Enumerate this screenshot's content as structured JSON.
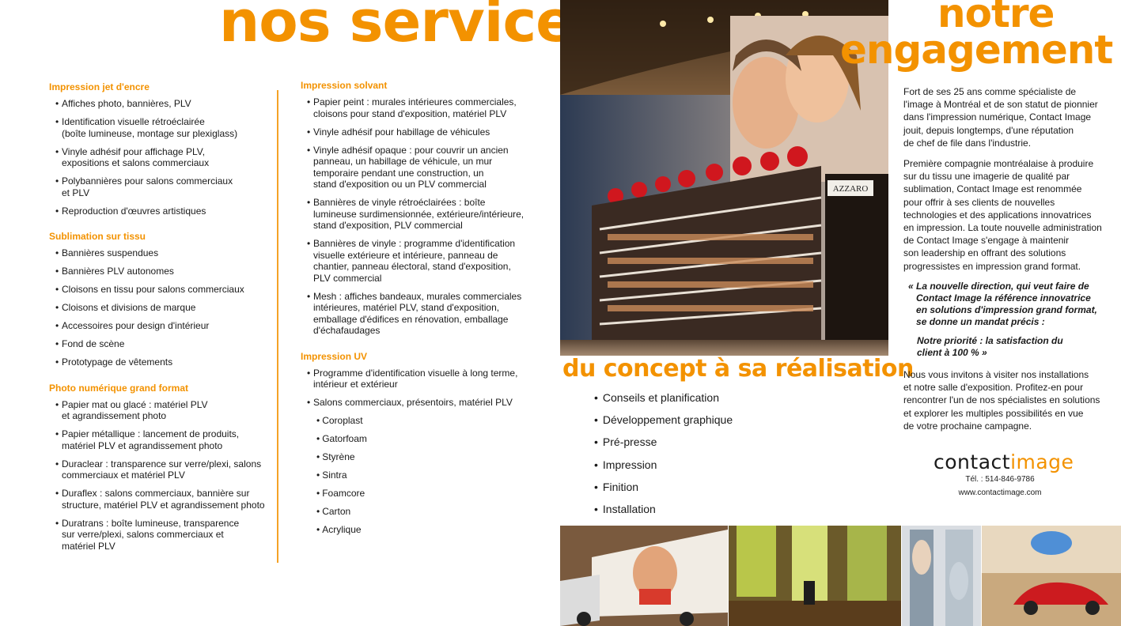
{
  "colors": {
    "accent": "#f39200",
    "text": "#1a1a1a"
  },
  "left": {
    "title": "nos services",
    "col1": [
      {
        "heading": "Impression jet d'encre",
        "items": [
          "Affiches photo, bannières, PLV",
          "Identification visuelle rétroéclairée\n(boîte lumineuse, montage sur plexiglass)",
          "Vinyle adhésif pour affichage PLV,\nexpositions et salons commerciaux",
          "Polybannières pour salons commerciaux\net PLV",
          "Reproduction d'œuvres artistiques"
        ]
      },
      {
        "heading": "Sublimation sur tissu",
        "items": [
          "Bannières suspendues",
          "Bannières PLV autonomes",
          "Cloisons en tissu pour salons commerciaux",
          "Cloisons et divisions de marque",
          "Accessoires pour design d'intérieur",
          "Fond de scène",
          "Prototypage de vêtements"
        ]
      },
      {
        "heading": "Photo numérique grand format",
        "items": [
          "Papier mat ou glacé : matériel PLV\net agrandissement photo",
          "Papier métallique : lancement de produits,\nmatériel PLV et agrandissement photo",
          "Duraclear : transparence sur verre/plexi, salons\ncommerciaux et matériel PLV",
          "Duraflex : salons commerciaux, bannière sur\nstructure, matériel PLV et agrandissement photo",
          "Duratrans : boîte lumineuse, transparence\nsur verre/plexi, salons commerciaux et\nmatériel PLV"
        ]
      }
    ],
    "col2": [
      {
        "heading": "Impression solvant",
        "items": [
          "Papier peint : murales intérieures commerciales,\ncloisons pour stand d'exposition, matériel PLV",
          "Vinyle adhésif pour habillage de véhicules",
          "Vinyle adhésif opaque : pour couvrir un ancien\npanneau, un habillage de véhicule, un mur\ntemporaire pendant une construction, un\nstand d'exposition ou un PLV commercial",
          "Bannières de vinyle rétroéclairées : boîte\nlumineuse surdimensionnée, extérieure/intérieure,\nstand d'exposition, PLV commercial",
          "Bannières de vinyle : programme d'identification\nvisuelle extérieure et intérieure, panneau de\nchantier, panneau électoral, stand d'exposition,\nPLV commercial",
          "Mesh : affiches bandeaux, murales commerciales\nintérieures, matériel PLV, stand d'exposition,\nemballage d'édifices en rénovation, emballage\nd'échafaudages"
        ]
      },
      {
        "heading": "Impression UV",
        "items": [
          "Programme d'identification visuelle à long terme,\nintérieur et extérieur",
          "Salons commerciaux, présentoirs, matériel PLV"
        ],
        "subitems": [
          "Coroplast",
          "Gatorfoam",
          "Styrène",
          "Sintra",
          "Foamcore",
          "Carton",
          "Acrylique"
        ]
      }
    ]
  },
  "middle": {
    "photo_sign": "AZZARO",
    "concept_title": "du concept à sa réalisation",
    "concept_items": [
      "Conseils et planification",
      "Développement graphique",
      "Pré-presse",
      "Impression",
      "Finition",
      "Installation"
    ]
  },
  "right": {
    "title_line1": "notre",
    "title_line2": "engagement",
    "paragraphs": [
      "Fort de ses 25 ans comme spécialiste de\nl'image à Montréal et de son statut de pionnier\ndans l'impression numérique, Contact Image\njouit, depuis longtemps, d'une réputation\nde chef de file dans l'industrie.",
      "Première compagnie montréalaise à produire\nsur du tissu une imagerie de qualité par\nsublimation, Contact Image est renommée\npour offrir à ses clients de nouvelles\ntechnologies et des applications innovatrices\nen impression. La toute nouvelle administration\nde Contact Image s'engage à maintenir\nson leadership en offrant des solutions\nprogressistes en impression grand format."
    ],
    "quote1": "« La nouvelle direction, qui veut faire de\n   Contact Image la référence innovatrice\n   en solutions d'impression grand format,\n   se donne un mandat précis :",
    "quote2": "Notre priorité : la satisfaction du\nclient à 100 % »",
    "closing": "Nous vous invitons à visiter nos installations\net notre salle d'exposition. Profitez-en pour\nrencontrer l'un de nos spécialistes en solutions\net explorer les multiples possibilités en vue\nde votre prochaine campagne.",
    "logo_word1": "contact",
    "logo_word2": "image",
    "phone": "Tél. : 514-846-9786",
    "website": "www.contactimage.com"
  }
}
